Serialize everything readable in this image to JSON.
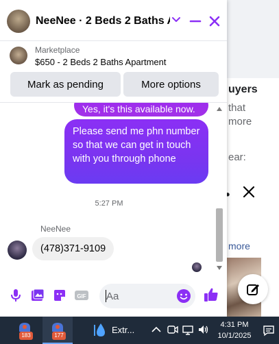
{
  "background": {
    "buyers_text": "uyers",
    "that_text": "that",
    "more_text": "more",
    "ear_text": "ear:",
    "dot_text": "•",
    "more_link": "more"
  },
  "chat": {
    "title": "NeeNee · 2 Beds 2 Baths A...",
    "accent_color": "#8b2ff5",
    "listing": {
      "label": "Marketplace",
      "title": "$650 - 2 Beds 2 Baths Apartment",
      "mark_pending_label": "Mark as pending",
      "more_options_label": "More options"
    },
    "messages": {
      "previous_outgoing": "Yes, it's this available now.",
      "outgoing": "Please send me  phn number so that we can get in touch with you through phone",
      "timestamp": "5:27 PM",
      "sender_name": "NeeNee",
      "incoming": "(478)371-9109"
    },
    "composer": {
      "placeholder": "Aa"
    }
  },
  "taskbar": {
    "app1_badge": "183",
    "app2_badge": "177",
    "extr_label": "Extr...",
    "time": "4:31 PM",
    "date": "10/1/2025"
  }
}
